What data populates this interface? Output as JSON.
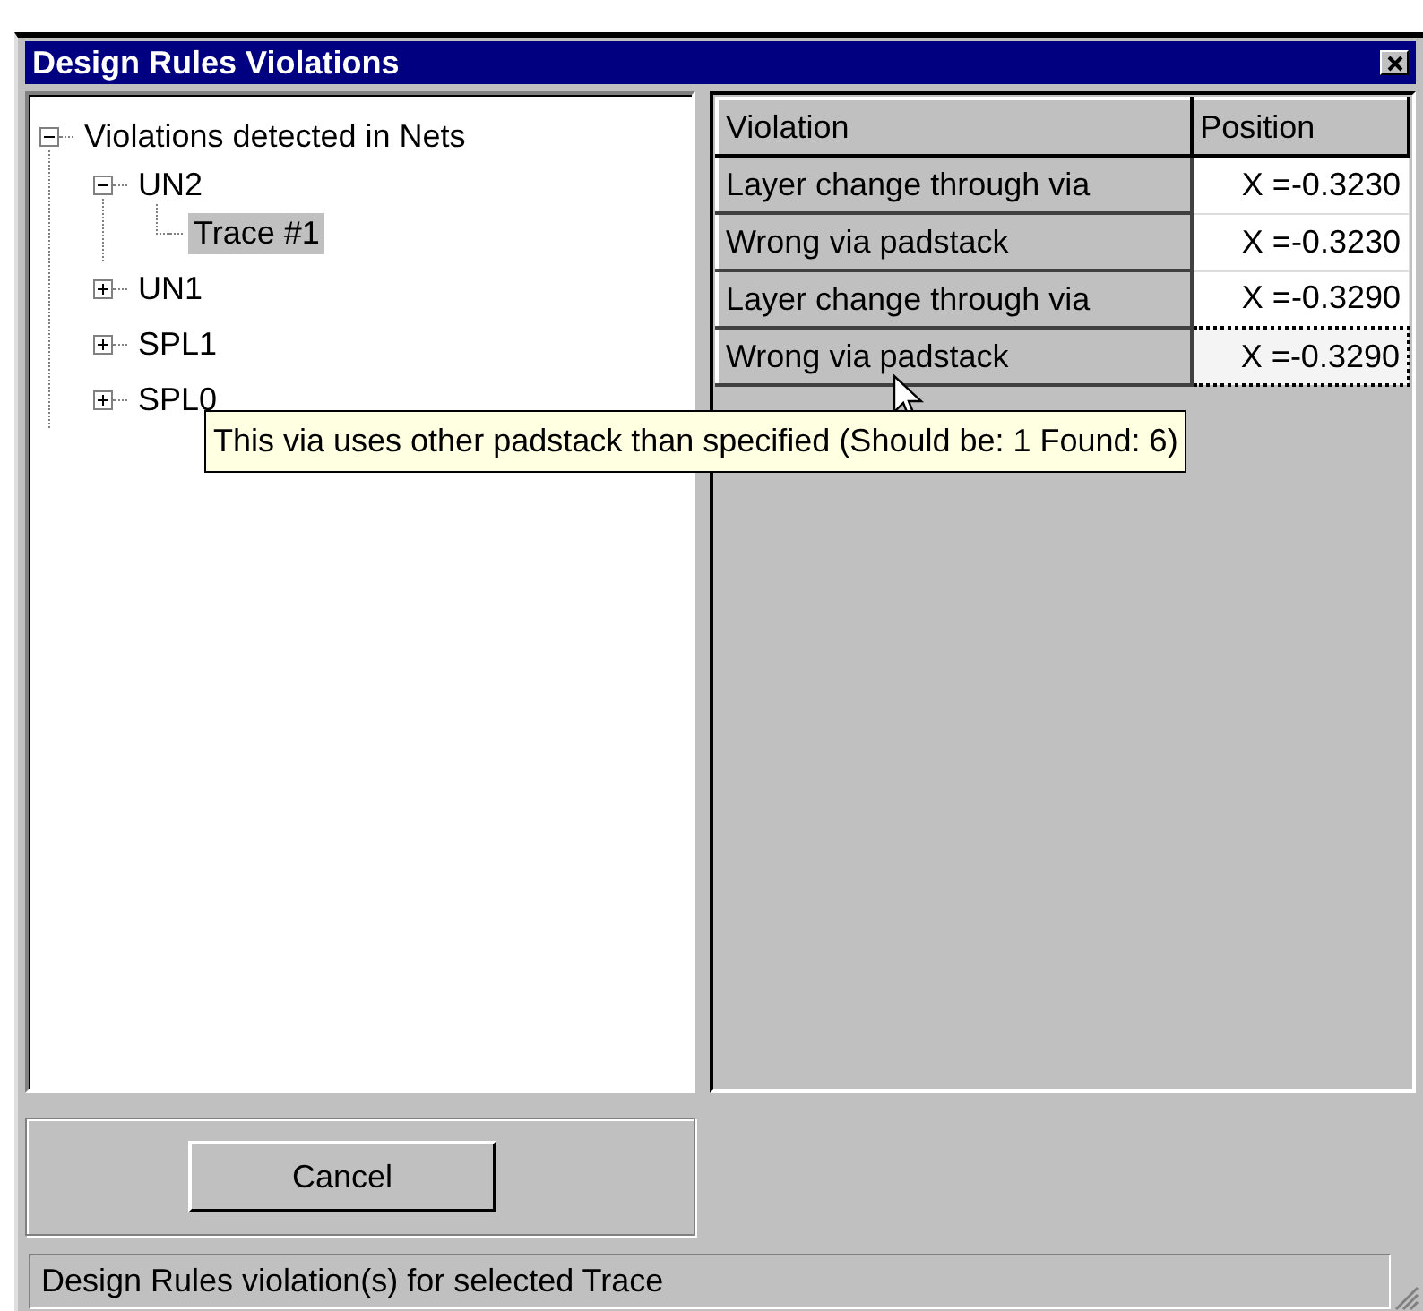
{
  "window": {
    "title": "Design Rules Violations"
  },
  "tree": [
    {
      "label": "Violations detected in Nets",
      "expanded": true,
      "selected": false,
      "children": [
        {
          "label": "UN2",
          "expanded": true,
          "selected": false,
          "children": [
            {
              "label": "Trace #1",
              "selected": true
            }
          ]
        },
        {
          "label": "UN1",
          "expanded": false,
          "selected": false
        },
        {
          "label": "SPL1",
          "expanded": false,
          "selected": false
        },
        {
          "label": "SPL0",
          "expanded": false,
          "selected": false
        }
      ]
    }
  ],
  "table": {
    "columns": [
      "Violation",
      "Position"
    ],
    "rows": [
      {
        "violation": "Layer change through via",
        "position": "X =-0.3230",
        "selected": false
      },
      {
        "violation": "Wrong via padstack",
        "position": "X =-0.3230",
        "selected": false
      },
      {
        "violation": "Layer change through via",
        "position": "X =-0.3290",
        "selected": false
      },
      {
        "violation": "Wrong via padstack",
        "position": "X =-0.3290",
        "selected": true
      }
    ]
  },
  "tooltip": {
    "text": "This via uses other padstack than specified (Should be: 1  Found: 6)"
  },
  "buttons": [
    "Cancel"
  ],
  "status_bar": {
    "text": "Design Rules violation(s) for selected Trace"
  }
}
